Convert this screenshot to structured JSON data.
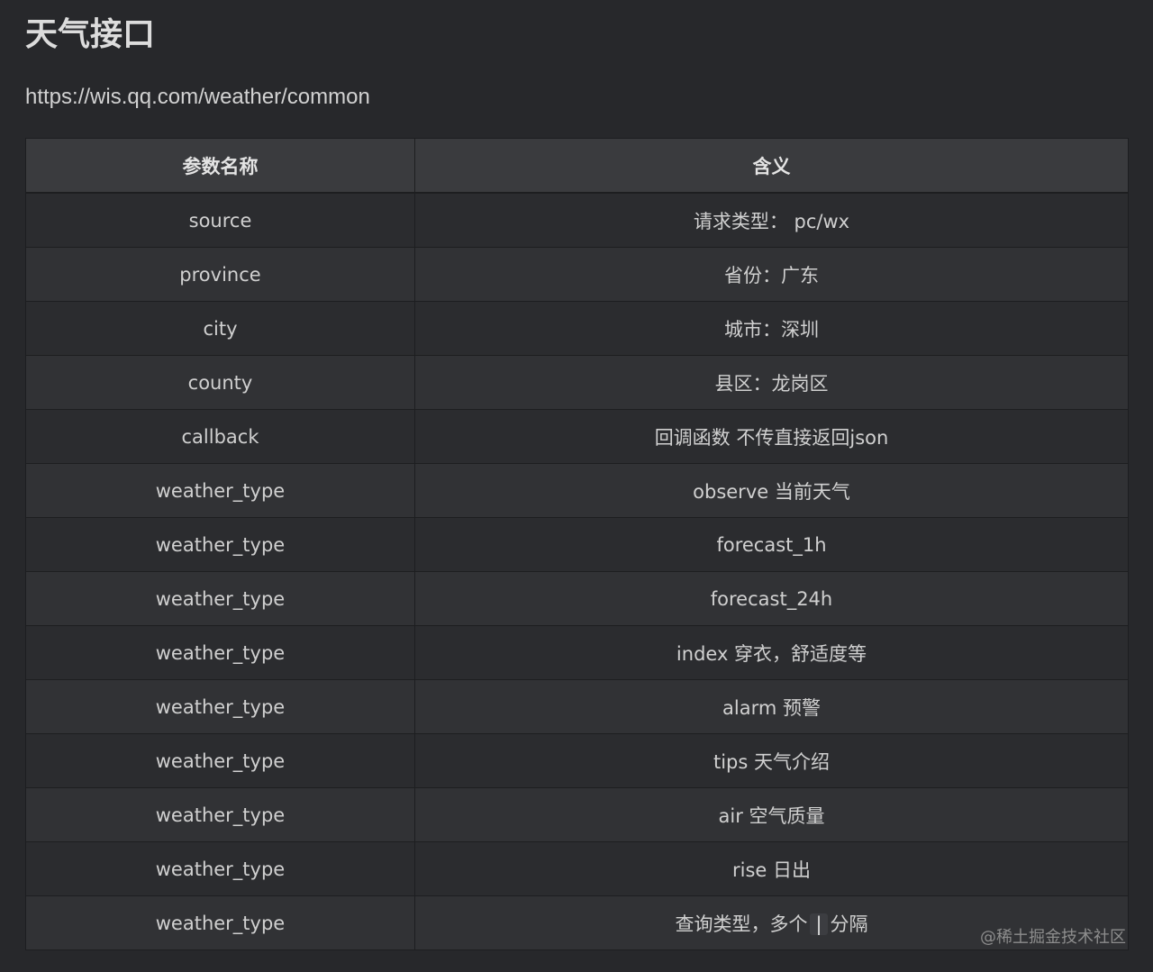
{
  "page": {
    "title": "天气接口",
    "url": "https://wis.qq.com/weather/common"
  },
  "table": {
    "headers": [
      "参数名称",
      "含义"
    ],
    "rows": [
      {
        "param": "source",
        "meaning": "请求类型： pc/wx"
      },
      {
        "param": "province",
        "meaning": "省份：广东"
      },
      {
        "param": "city",
        "meaning": "城市：深圳"
      },
      {
        "param": "county",
        "meaning": "县区：龙岗区"
      },
      {
        "param": "callback",
        "meaning": "回调函数 不传直接返回json"
      },
      {
        "param": "weather_type",
        "meaning": "observe 当前天气"
      },
      {
        "param": "weather_type",
        "meaning": "forecast_1h"
      },
      {
        "param": "weather_type",
        "meaning": "forecast_24h"
      },
      {
        "param": "weather_type",
        "meaning": "index 穿衣，舒适度等"
      },
      {
        "param": "weather_type",
        "meaning": "alarm 预警"
      },
      {
        "param": "weather_type",
        "meaning": "tips 天气介绍"
      },
      {
        "param": "weather_type",
        "meaning": "air 空气质量"
      },
      {
        "param": "weather_type",
        "meaning": "rise 日出"
      },
      {
        "param": "weather_type",
        "meaning_prefix": "查询类型，多个",
        "meaning_code": "|",
        "meaning_suffix": "分隔"
      }
    ]
  },
  "watermark": "@稀土掘金技术社区",
  "colors": {
    "background": "#27282b",
    "header_background": "#3a3b3e",
    "row_odd": "#2b2c2f",
    "row_even": "#313235",
    "text": "#d0d0d0"
  }
}
